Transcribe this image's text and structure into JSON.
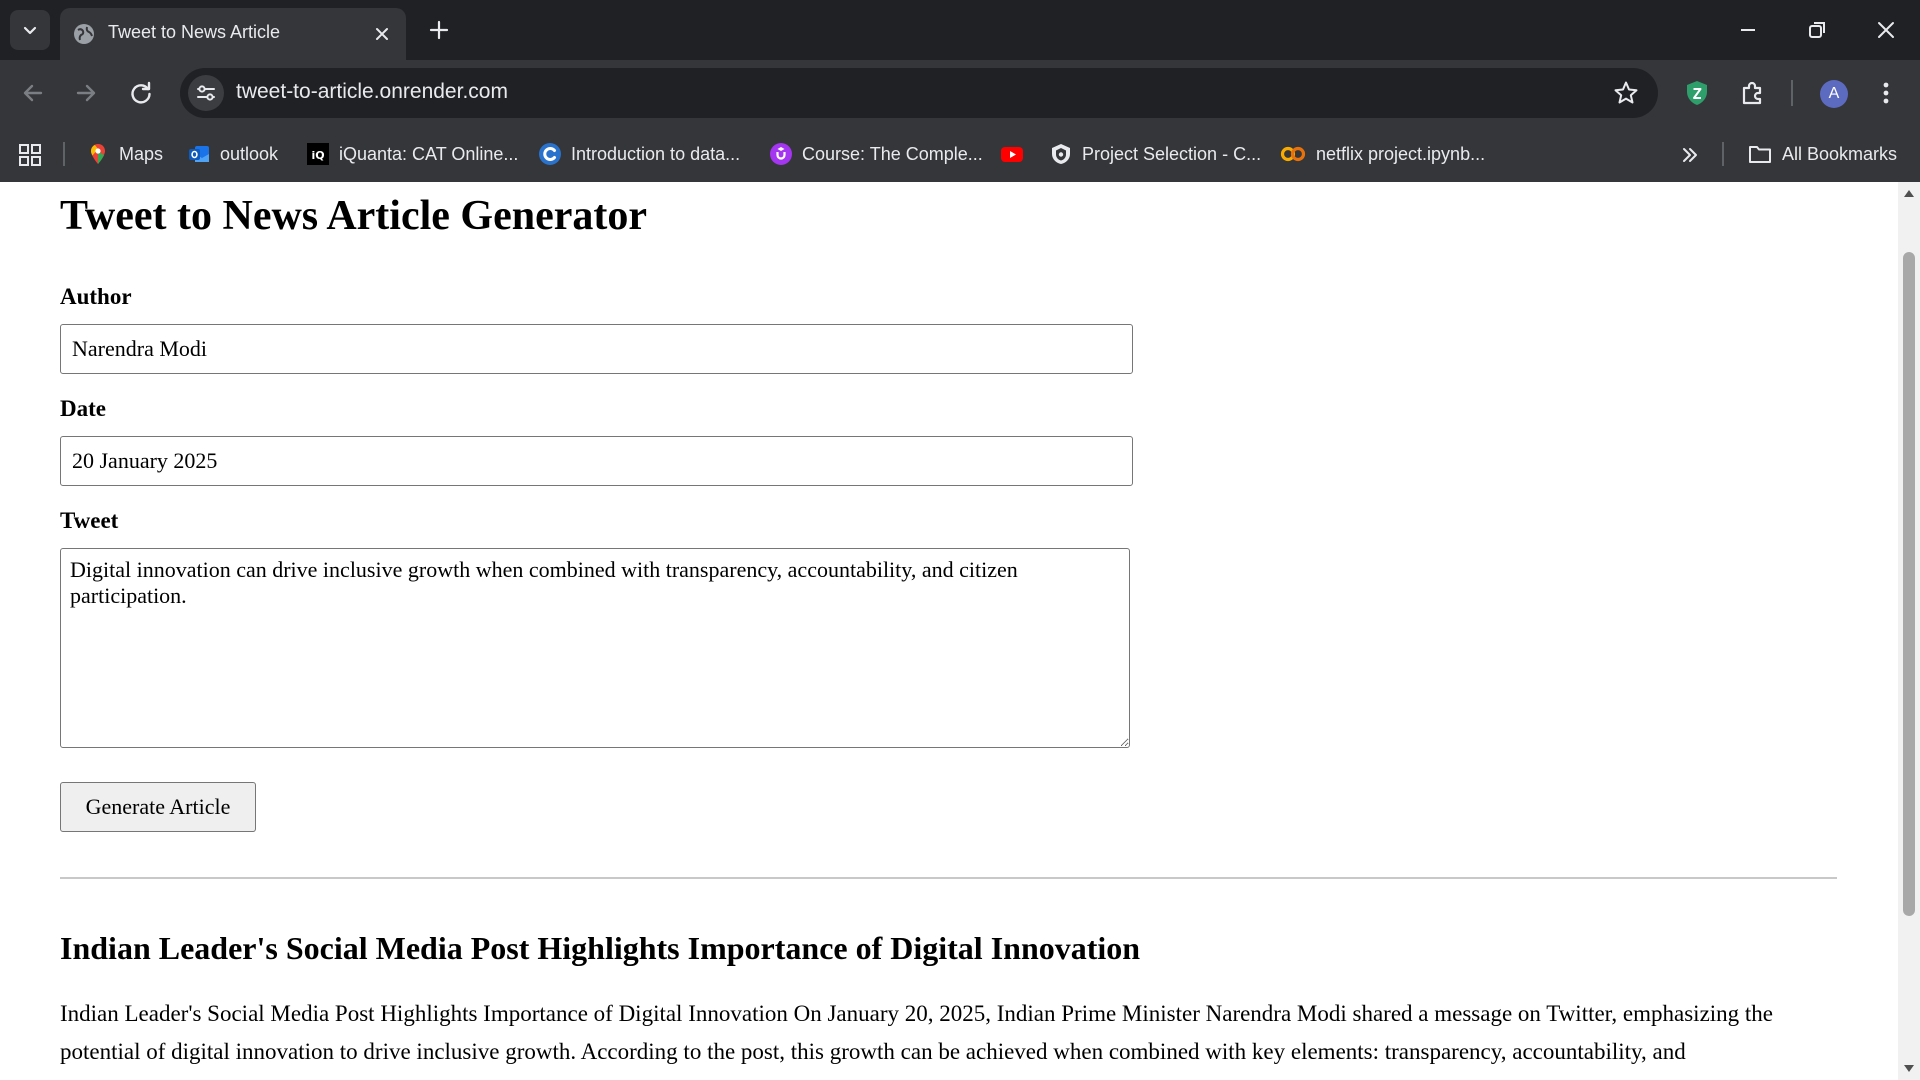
{
  "browser": {
    "tab": {
      "title": "Tweet to News Article"
    },
    "url": "tweet-to-article.onrender.com",
    "profile_initial": "A",
    "bookmarks": [
      {
        "label": "Maps",
        "icon": "maps-pin-icon"
      },
      {
        "label": "outlook",
        "icon": "outlook-icon"
      },
      {
        "label": "iQuanta: CAT Online...",
        "icon": "iquanta-icon"
      },
      {
        "label": "Introduction to data...",
        "icon": "coursera-icon"
      },
      {
        "label": "Course: The Comple...",
        "icon": "udemy-icon"
      },
      {
        "label": "",
        "icon": "youtube-icon"
      },
      {
        "label": "Project Selection - C...",
        "icon": "shield-logo-icon"
      },
      {
        "label": "netflix project.ipynb...",
        "icon": "colab-icon"
      }
    ],
    "all_bookmarks_label": "All Bookmarks",
    "colors": {
      "frame": "#202124",
      "toolbar": "#35363a",
      "text": "#e8eaed"
    }
  },
  "page": {
    "title": "Tweet to News Article Generator",
    "author": {
      "label": "Author",
      "value": "Narendra Modi"
    },
    "date": {
      "label": "Date",
      "value": "20 January 2025"
    },
    "tweet": {
      "label": "Tweet",
      "value": "Digital innovation can drive inclusive growth when combined with transparency, accountability, and citizen participation."
    },
    "generate_label": "Generate Article",
    "article": {
      "title": "Indian Leader's Social Media Post Highlights Importance of Digital Innovation",
      "body": "Indian Leader's Social Media Post Highlights Importance of Digital Innovation On January 20, 2025, Indian Prime Minister Narendra Modi shared a message on Twitter, emphasizing the potential of digital innovation to drive inclusive growth. According to the post, this growth can be achieved when combined with key elements: transparency, accountability, and"
    }
  }
}
